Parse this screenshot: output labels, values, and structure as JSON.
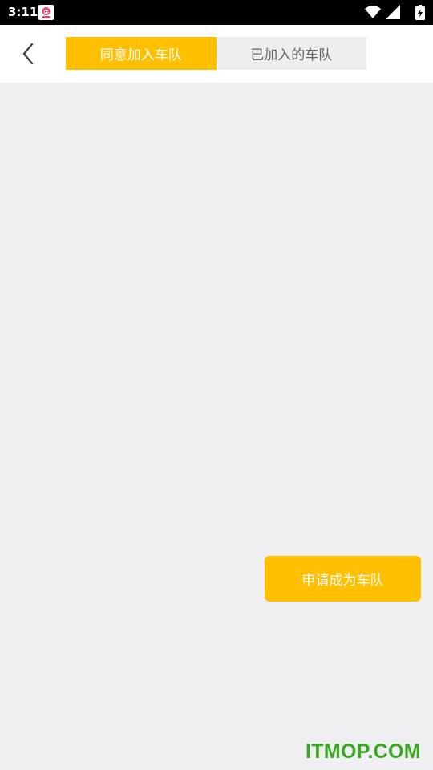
{
  "status_bar": {
    "time": "3:11",
    "icons": [
      "app-notification-icon",
      "wifi-icon",
      "cellular-signal-icon",
      "battery-charging-icon"
    ]
  },
  "header": {
    "back_icon": "chevron-left-icon",
    "tabs": [
      {
        "label": "同意加入车队",
        "active": true
      },
      {
        "label": "已加入的车队",
        "active": false
      }
    ]
  },
  "main": {
    "apply_button_label": "申请成为车队"
  },
  "watermark": "ITMOP.COM",
  "colors": {
    "accent": "#ffc001",
    "background": "#efeef0",
    "inactive_tab": "#eeeeee",
    "watermark": "#39a821"
  }
}
